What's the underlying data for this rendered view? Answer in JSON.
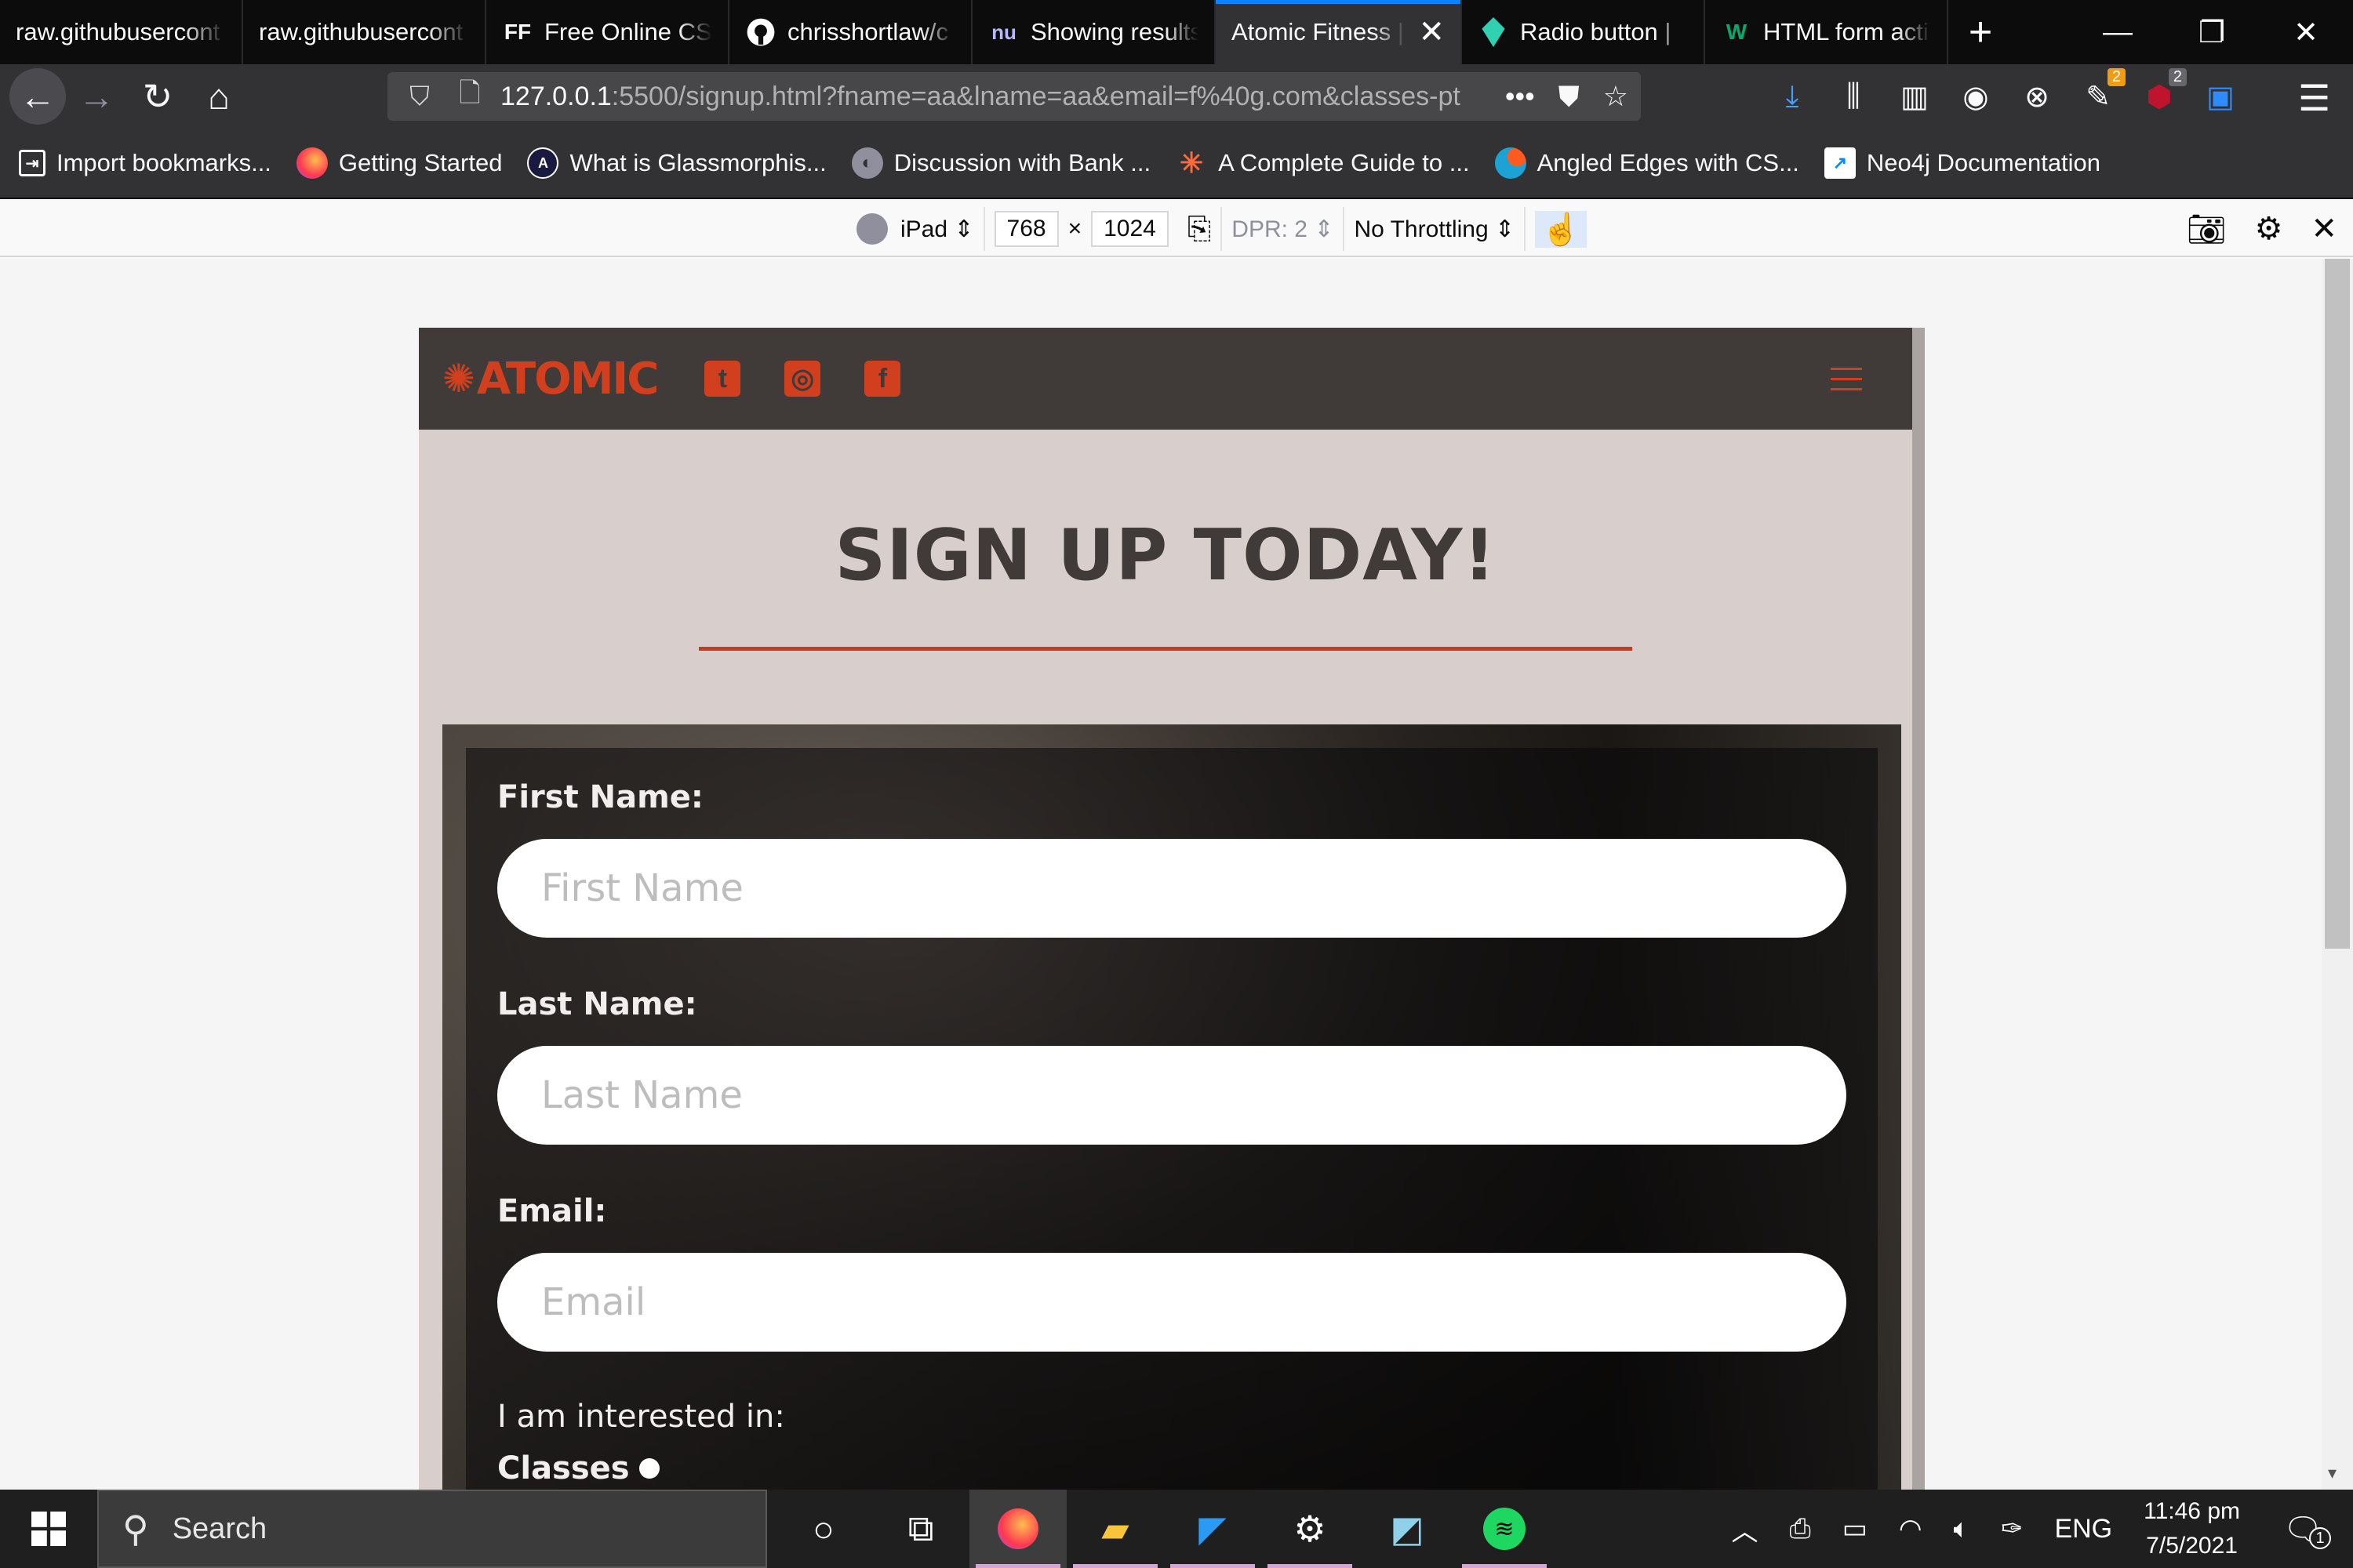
{
  "browser": {
    "tabs": [
      {
        "title": "raw.githubusercont",
        "favicon": "none",
        "active": false
      },
      {
        "title": "raw.githubusercont",
        "favicon": "none",
        "active": false
      },
      {
        "title": "Free Online CSS",
        "favicon": "FF",
        "active": false
      },
      {
        "title": "chrisshortlaw/c",
        "favicon": "github-icon",
        "active": false
      },
      {
        "title": "Showing results",
        "favicon": "nu",
        "active": false
      },
      {
        "title": "Atomic Fitness |",
        "favicon": "none",
        "active": true
      },
      {
        "title": "Radio button |",
        "favicon": "leaf-icon",
        "active": false
      },
      {
        "title": "HTML form acti",
        "favicon": "W",
        "active": false
      }
    ],
    "url": {
      "host": "127.0.0.1",
      "path": ":5500/signup.html?fname=aa&lname=aa&email=f%40g.com&classes-pt"
    },
    "toolbar_badges": {
      "extension_a": "2",
      "ublock": "2"
    },
    "bookmarks": [
      {
        "label": "Import bookmarks...",
        "icon": "import-icon"
      },
      {
        "label": "Getting Started",
        "icon": "firefox-icon"
      },
      {
        "label": "What is Glassmorphis...",
        "icon": "glassmorphism-icon"
      },
      {
        "label": "Discussion with Bank ...",
        "icon": "discussion-icon"
      },
      {
        "label": "A Complete Guide to ...",
        "icon": "star-burst-icon"
      },
      {
        "label": "Angled Edges with CS...",
        "icon": "dot-icon"
      },
      {
        "label": "Neo4j Documentation",
        "icon": "neo4j-icon"
      }
    ],
    "colors": {
      "tab_active_accent": "#0a84ff",
      "chrome_dark": "#0c0c0d"
    }
  },
  "responsive_mode": {
    "device": "iPad",
    "width": "768",
    "times": "×",
    "height": "1024",
    "dpr": "DPR: 2",
    "throttling": "No Throttling"
  },
  "site": {
    "logo_text": "ATOMIC",
    "social_icons": [
      "twitter-icon",
      "instagram-icon",
      "facebook-icon"
    ],
    "page_title": "SIGN UP TODAY!",
    "accent_color": "#d23f1f",
    "form": {
      "first_name_label": "First Name:",
      "first_name_placeholder": "First Name",
      "last_name_label": "Last Name:",
      "last_name_placeholder": "Last Name",
      "email_label": "Email:",
      "email_placeholder": "Email",
      "interest_label": "I am interested in:",
      "classes_option": "Classes"
    }
  },
  "taskbar": {
    "search_placeholder": "Search",
    "language": "ENG",
    "time": "11:46 pm",
    "date": "7/5/2021",
    "notification_count": "1"
  }
}
